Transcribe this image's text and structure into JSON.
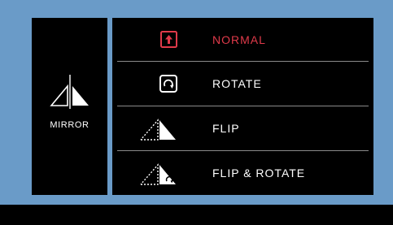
{
  "colors": {
    "background": "#6a9bc8",
    "panel": "#000000",
    "text": "#ffffff",
    "selected": "#e03a4a",
    "divider": "#8a8a8a"
  },
  "mirror": {
    "label": "MIRROR",
    "icon": "mirror-triangles-icon"
  },
  "menu": {
    "items": [
      {
        "label": "NORMAL",
        "icon": "arrow-up-box-icon",
        "selected": true
      },
      {
        "label": "ROTATE",
        "icon": "rotate-box-icon",
        "selected": false
      },
      {
        "label": "FLIP",
        "icon": "flip-triangle-icon",
        "selected": false
      },
      {
        "label": "FLIP & ROTATE",
        "icon": "flip-rotate-icon",
        "selected": false
      }
    ]
  }
}
